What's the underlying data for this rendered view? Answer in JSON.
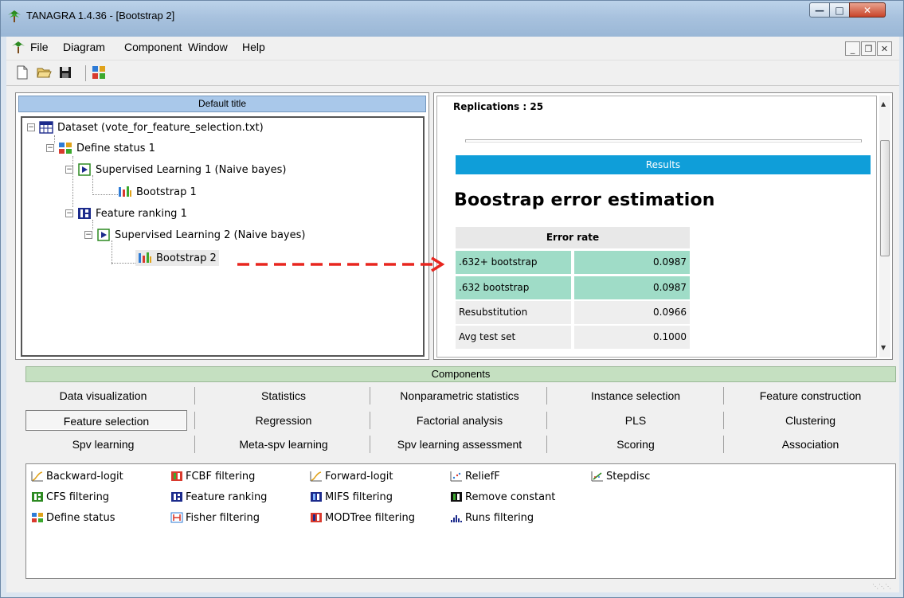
{
  "window": {
    "title": "TANAGRA 1.4.36 - [Bootstrap 2]"
  },
  "menu": {
    "items": [
      "File",
      "Diagram",
      "Component",
      "Window",
      "Help"
    ]
  },
  "left_pane": {
    "title": "Default title",
    "tree": [
      {
        "label": "Dataset (vote_for_feature_selection.txt)",
        "icon": "dataset-icon"
      },
      {
        "label": "Define status 1",
        "icon": "define-status-icon"
      },
      {
        "label": "Supervised Learning 1 (Naive bayes)",
        "icon": "supervised-learning-icon"
      },
      {
        "label": "Bootstrap 1",
        "icon": "bootstrap-icon"
      },
      {
        "label": "Feature ranking 1",
        "icon": "feature-ranking-icon"
      },
      {
        "label": "Supervised Learning 2 (Naive bayes)",
        "icon": "supervised-learning-icon"
      },
      {
        "label": "Bootstrap 2",
        "icon": "bootstrap-icon"
      }
    ]
  },
  "right_pane": {
    "replications": "Replications : 25",
    "results_label": "Results",
    "heading": "Boostrap error estimation",
    "table_header": "Error rate",
    "rows": [
      {
        "name": ".632+ bootstrap",
        "value": "0.0987"
      },
      {
        "name": ".632 bootstrap",
        "value": "0.0987"
      },
      {
        "name": "Resubstitution",
        "value": "0.0966"
      },
      {
        "name": "Avg test set",
        "value": "0.1000"
      }
    ]
  },
  "components": {
    "header": "Components",
    "tabs": [
      [
        "Data visualization",
        "Statistics",
        "Nonparametric statistics",
        "Instance selection",
        "Feature construction"
      ],
      [
        "Feature selection",
        "Regression",
        "Factorial analysis",
        "PLS",
        "Clustering"
      ],
      [
        "Spv learning",
        "Meta-spv learning",
        "Spv learning assessment",
        "Scoring",
        "Association"
      ]
    ],
    "active_tab": "Feature selection",
    "items": [
      {
        "label": "Backward-logit",
        "icon": "backward-logit-icon"
      },
      {
        "label": "CFS filtering",
        "icon": "cfs-filtering-icon"
      },
      {
        "label": "Define status",
        "icon": "define-status-icon"
      },
      {
        "label": "FCBF filtering",
        "icon": "fcbf-filtering-icon"
      },
      {
        "label": "Feature ranking",
        "icon": "feature-ranking-icon"
      },
      {
        "label": "Fisher filtering",
        "icon": "fisher-filtering-icon"
      },
      {
        "label": "Forward-logit",
        "icon": "forward-logit-icon"
      },
      {
        "label": "MIFS filtering",
        "icon": "mifs-filtering-icon"
      },
      {
        "label": "MODTree filtering",
        "icon": "modtree-filtering-icon"
      },
      {
        "label": "ReliefF",
        "icon": "relieff-icon"
      },
      {
        "label": "Remove constant",
        "icon": "remove-constant-icon"
      },
      {
        "label": "Runs filtering",
        "icon": "runs-filtering-icon"
      },
      {
        "label": "Stepdisc",
        "icon": "stepdisc-icon"
      }
    ]
  },
  "colors": {
    "results_bar": "#0f9ed9",
    "highlight_row": "#9fdcc7",
    "arrow": "#e8261f",
    "components_header": "#c5e0c1",
    "pane_title": "#a9c8ea"
  }
}
